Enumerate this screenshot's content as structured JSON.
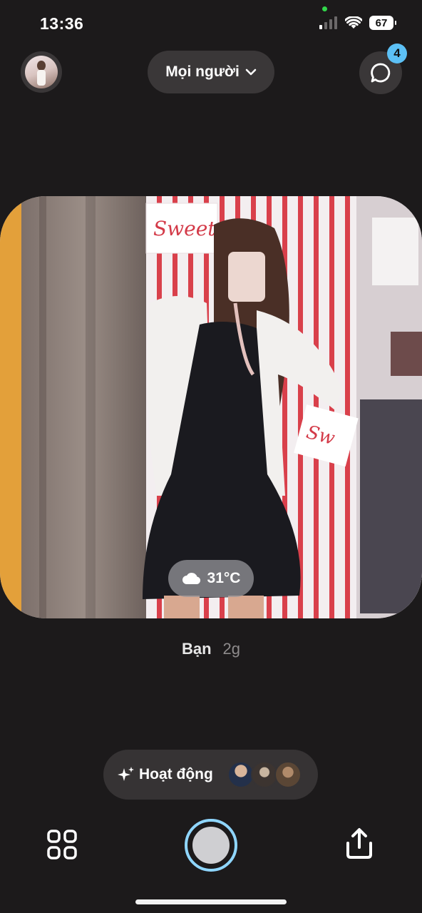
{
  "status_bar": {
    "time": "13:36",
    "battery": "67"
  },
  "header": {
    "audience_label": "Mọi người",
    "chat_badge_count": "4"
  },
  "photo": {
    "weather": "31°C",
    "sign_text_1": "Sweet",
    "sign_text_2": "Sw"
  },
  "caption": {
    "author": "Bạn",
    "time_ago": "2g"
  },
  "activity": {
    "label": "Hoạt động"
  },
  "colors": {
    "accent": "#8fd6ff",
    "badge": "#5cc0f5",
    "background": "#1c1a1b"
  }
}
